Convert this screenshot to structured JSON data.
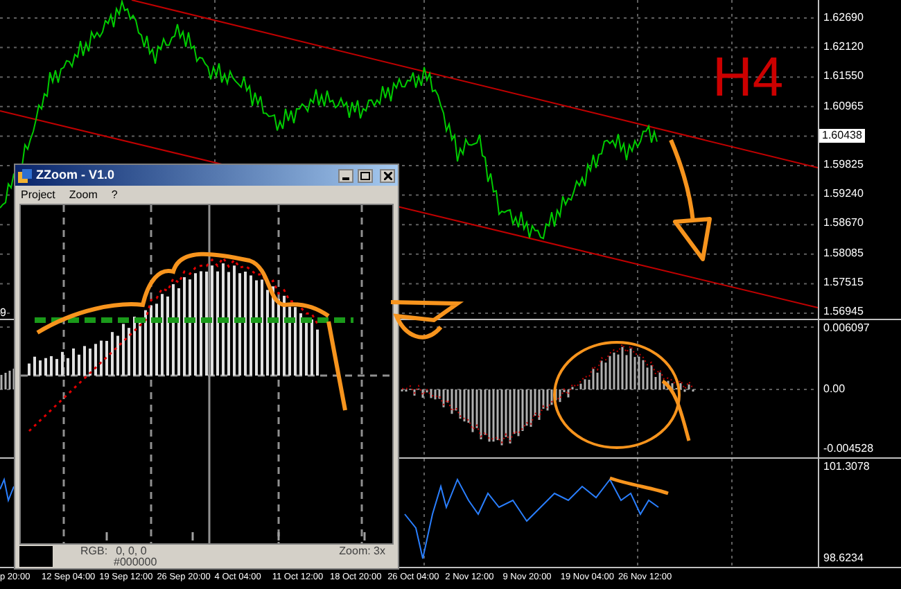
{
  "left_edge_label": "9",
  "price_chart": {
    "timeframe_label": "H4",
    "axis_labels": [
      {
        "text": "1.62690",
        "current": false
      },
      {
        "text": "1.62120",
        "current": false
      },
      {
        "text": "1.61550",
        "current": false
      },
      {
        "text": "1.60965",
        "current": false
      },
      {
        "text": "1.60438",
        "current": true
      },
      {
        "text": "1.59825",
        "current": false
      },
      {
        "text": "1.59240",
        "current": false
      },
      {
        "text": "1.58670",
        "current": false
      },
      {
        "text": "1.58085",
        "current": false
      },
      {
        "text": "1.57515",
        "current": false
      },
      {
        "text": "1.56945",
        "current": false
      }
    ]
  },
  "oscillator": {
    "axis_labels": [
      "0.006097",
      "0.00",
      "-0.004528"
    ]
  },
  "index_panel": {
    "axis_labels": [
      "101.3078",
      "98.6234"
    ]
  },
  "time_axis": {
    "labels": [
      "p 20:00",
      "12 Sep 04:00",
      "19 Sep 12:00",
      "26 Sep 20:00",
      "4 Oct 04:00",
      "11 Oct 12:00",
      "18 Oct 20:00",
      "26 Oct 04:00",
      "2 Nov 12:00",
      "9 Nov 20:00",
      "19 Nov 04:00",
      "26 Nov 12:00"
    ]
  },
  "zoom_window": {
    "title": "ZZoom - V1.0",
    "menu": [
      "Project",
      "Zoom",
      "?"
    ],
    "status": {
      "rgb_label": "RGB:",
      "rgb_value": "0, 0, 0",
      "hex": "#000000",
      "zoom": "Zoom: 3x"
    }
  }
}
